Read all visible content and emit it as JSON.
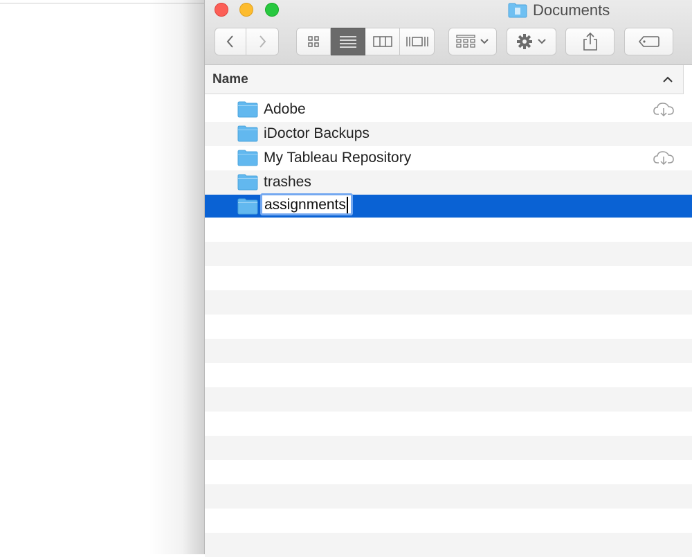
{
  "window": {
    "title": "Documents"
  },
  "toolbar": {
    "back_icon": "chevron-left-icon",
    "forward_icon": "chevron-right-icon",
    "view_modes": [
      "icon-view-icon",
      "list-view-icon",
      "column-view-icon",
      "gallery-view-icon"
    ],
    "active_view": "list",
    "group_icon": "group-grid-icon",
    "action_icon": "gear-icon",
    "share_icon": "share-icon",
    "tag_icon": "tag-icon"
  },
  "columns": {
    "name_header": "Name",
    "sort_icon": "chevron-up-icon"
  },
  "files": [
    {
      "name": "Adobe",
      "type": "folder",
      "cloud": true
    },
    {
      "name": "iDoctor Backups",
      "type": "folder",
      "cloud": false
    },
    {
      "name": "My Tableau Repository",
      "type": "folder",
      "cloud": true
    },
    {
      "name": "trashes",
      "type": "folder",
      "cloud": false
    },
    {
      "name": "assignments",
      "type": "folder",
      "cloud": false,
      "selected": true,
      "renaming": true
    }
  ],
  "colors": {
    "selection": "#0a62d4",
    "folder": "#5fb6ee",
    "close": "#fc5f57",
    "minimize": "#fdbc2e",
    "maximize": "#28c840"
  }
}
